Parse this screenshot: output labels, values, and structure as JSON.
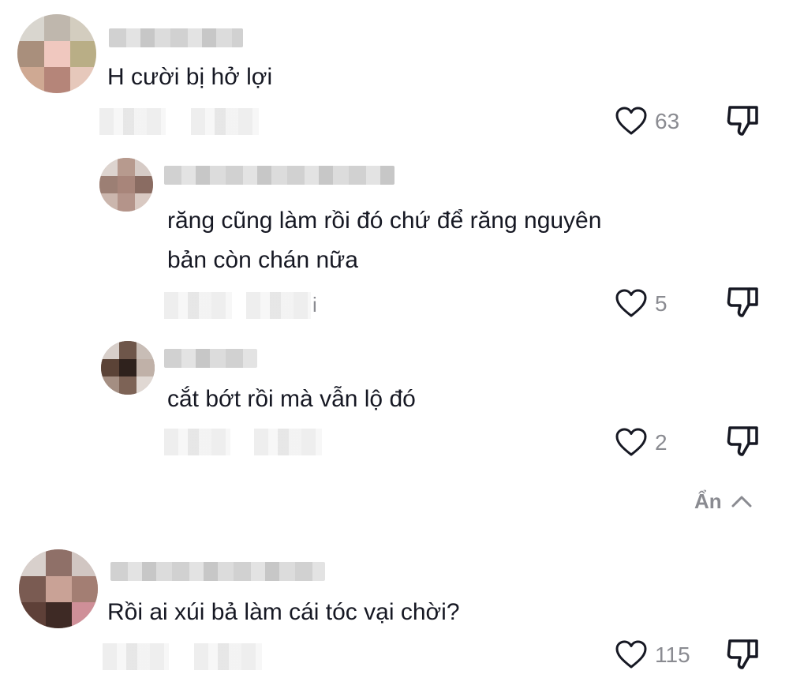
{
  "comments": [
    {
      "text": "H cười bị hở lợi",
      "likes": "63",
      "replies": [
        {
          "text_line1": "răng cũng làm rồi đó chứ để răng nguyên",
          "text_line2": "bản còn chán nữa",
          "likes": "5",
          "meta_suffix": "i"
        },
        {
          "text": "cắt bớt rồi mà vẫn lộ đó",
          "likes": "2"
        }
      ],
      "hide_label": "Ẩn"
    },
    {
      "text": "Rồi ai xúi bả làm cái tóc vại chời?",
      "likes": "115"
    }
  ],
  "icons": {
    "like": "heart-outline-icon",
    "dislike": "thumbs-down-icon",
    "collapse": "chevron-up-icon"
  },
  "colors": {
    "text": "#161823",
    "secondary": "#8a8b91"
  }
}
